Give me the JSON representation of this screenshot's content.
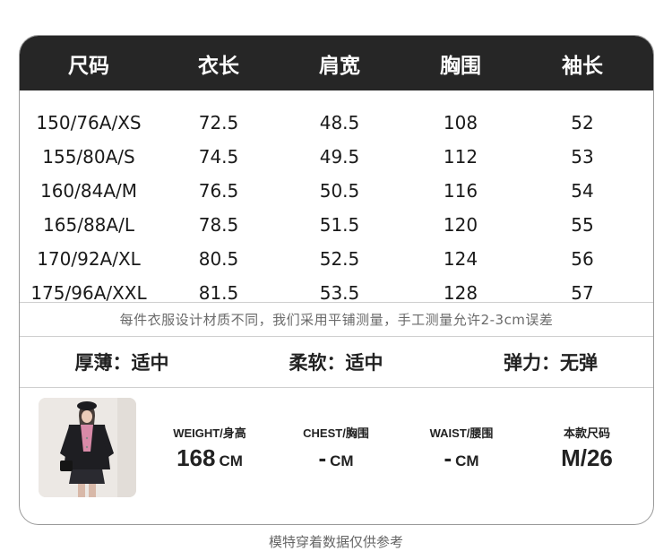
{
  "table": {
    "headers": [
      "尺码",
      "衣长",
      "肩宽",
      "胸围",
      "袖长"
    ],
    "rows": [
      [
        "150/76A/XS",
        "72.5",
        "48.5",
        "108",
        "52"
      ],
      [
        "155/80A/S",
        "74.5",
        "49.5",
        "112",
        "53"
      ],
      [
        "160/84A/M",
        "76.5",
        "50.5",
        "116",
        "54"
      ],
      [
        "165/88A/L",
        "78.5",
        "51.5",
        "120",
        "55"
      ],
      [
        "170/92A/XL",
        "80.5",
        "52.5",
        "124",
        "56"
      ],
      [
        "175/96A/XXL",
        "81.5",
        "53.5",
        "128",
        "57"
      ]
    ]
  },
  "note": "每件衣服设计材质不同，我们采用平铺测量，手工测量允许2-3cm误差",
  "properties": [
    "厚薄：适中",
    "柔软：适中",
    "弹力：无弹"
  ],
  "model": {
    "weight_label": "WEIGHT/身高",
    "weight_value": "168",
    "weight_unit": "CM",
    "chest_label": "CHEST/胸围",
    "chest_value": "-",
    "chest_unit": "CM",
    "waist_label": "WAIST/腰围",
    "waist_value": "-",
    "waist_unit": "CM",
    "size_label": "本款尺码",
    "size_value": "M/26"
  },
  "footer": "模特穿着数据仅供参考",
  "colors": {
    "header_bg": "#262626",
    "border": "#9a9a9a",
    "divider": "#cfcfcf"
  }
}
